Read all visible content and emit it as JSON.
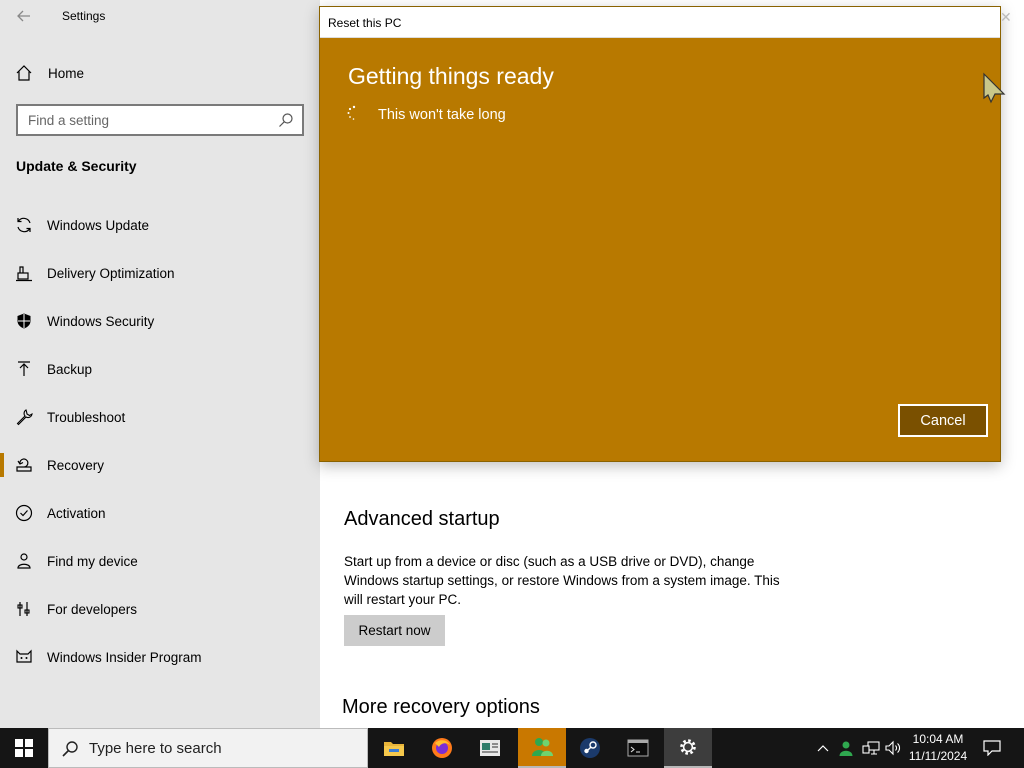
{
  "window": {
    "app_title": "Settings"
  },
  "sidebar": {
    "home_label": "Home",
    "search_placeholder": "Find a setting",
    "section_heading": "Update & Security",
    "items": [
      {
        "label": "Windows Update",
        "icon": "sync-icon"
      },
      {
        "label": "Delivery Optimization",
        "icon": "delivery-optimization-icon"
      },
      {
        "label": "Windows Security",
        "icon": "shield-icon"
      },
      {
        "label": "Backup",
        "icon": "backup-arrow-icon"
      },
      {
        "label": "Troubleshoot",
        "icon": "wrench-icon"
      },
      {
        "label": "Recovery",
        "icon": "recovery-icon",
        "selected": true
      },
      {
        "label": "Activation",
        "icon": "check-circle-icon"
      },
      {
        "label": "Find my device",
        "icon": "person-location-icon"
      },
      {
        "label": "For developers",
        "icon": "developer-tools-icon"
      },
      {
        "label": "Windows Insider Program",
        "icon": "insider-cat-icon"
      }
    ]
  },
  "main": {
    "advanced_startup": {
      "title": "Advanced startup",
      "description": "Start up from a device or disc (such as a USB drive or DVD), change Windows startup settings, or restore Windows from a system image. This will restart your PC.",
      "button_label": "Restart now"
    },
    "more_options_title": "More recovery options"
  },
  "dialog": {
    "title": "Reset this PC",
    "heading": "Getting things ready",
    "status": "This won't take long",
    "cancel_label": "Cancel",
    "background_color": "#b87900"
  },
  "taskbar": {
    "search_placeholder": "Type here to search",
    "apps": [
      "file-explorer-icon",
      "firefox-icon",
      "news-reader-icon",
      "people-app-icon",
      "steam-icon",
      "terminal-icon",
      "settings-gear-icon"
    ],
    "clock_time": "10:04 AM",
    "clock_date": "11/11/2024"
  },
  "colors": {
    "accent": "#b87900",
    "sidebar_bg": "#e6e6e6",
    "taskbar_bg": "#151515"
  }
}
